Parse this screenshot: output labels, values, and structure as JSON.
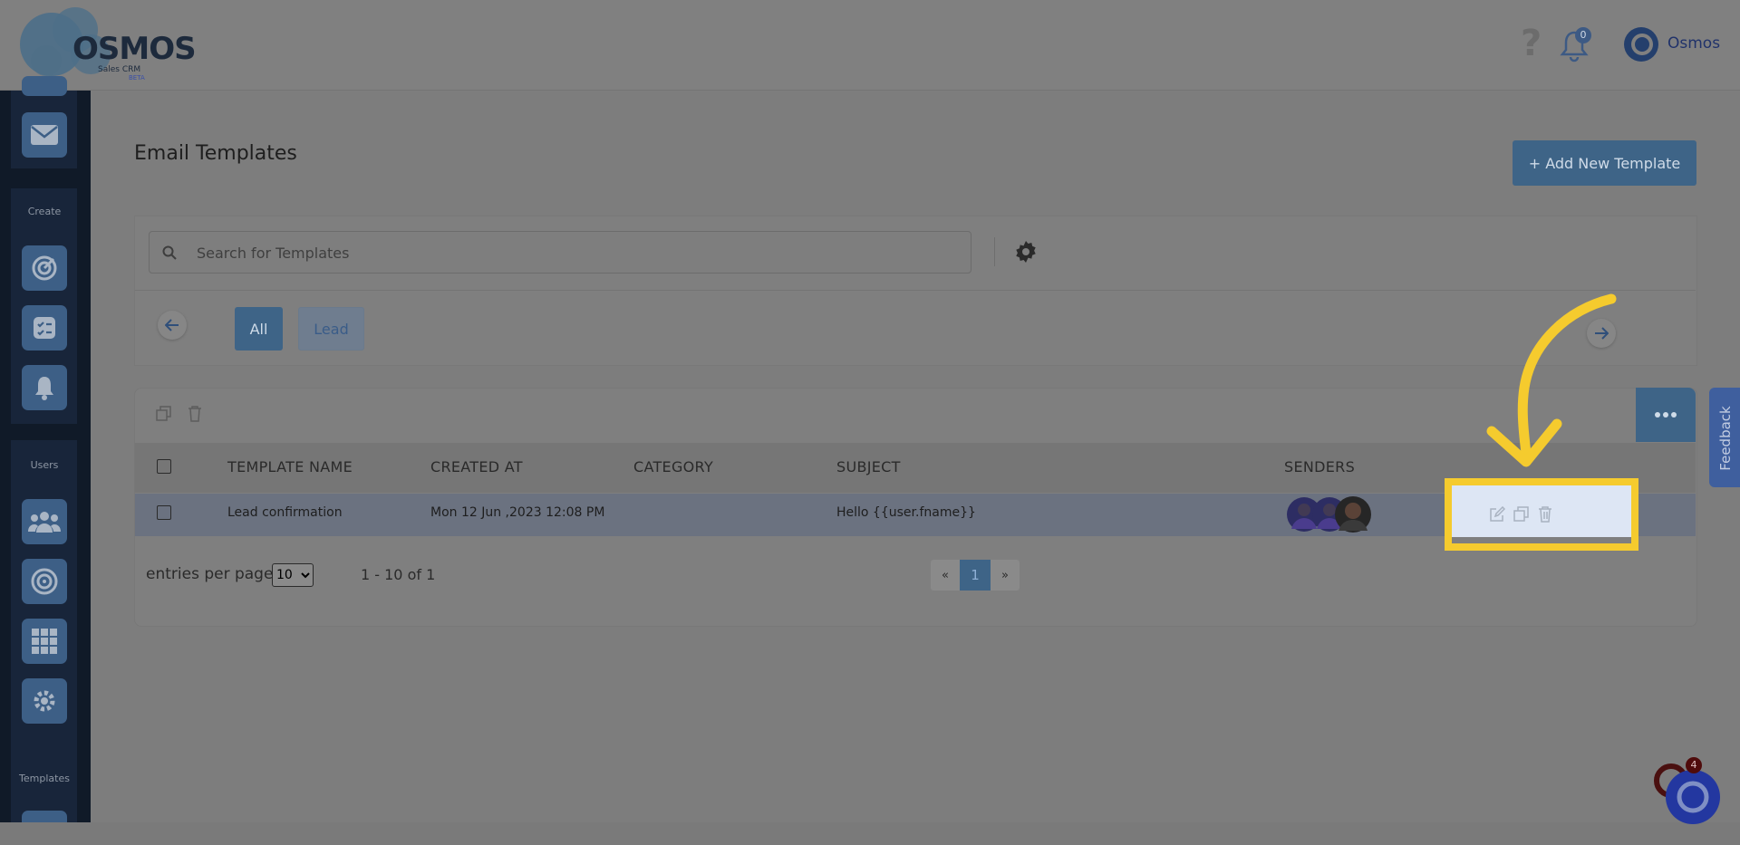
{
  "brand": {
    "logo_text": "OSMOS",
    "logo_sub": "Sales CRM",
    "logo_beta": "BETA"
  },
  "header": {
    "help_symbol": "?",
    "notification_count": "0",
    "user_name": "Osmos"
  },
  "sidebar": {
    "sections": {
      "create": "Create",
      "users": "Users",
      "templates": "Templates"
    }
  },
  "page": {
    "title": "Email Templates",
    "add_button": "+ Add New Template"
  },
  "search": {
    "placeholder": "Search for Templates"
  },
  "filters": {
    "all": "All",
    "lead": "Lead"
  },
  "table": {
    "headers": {
      "name": "TEMPLATE NAME",
      "created": "CREATED AT",
      "category": "CATEGORY",
      "subject": "SUBJECT",
      "senders": "SENDERS"
    },
    "rows": [
      {
        "name": "Lead confirmation",
        "created": "Mon 12 Jun ,2023 12:08 PM",
        "category": "",
        "subject": "Hello {{user.fname}}"
      }
    ]
  },
  "pagination": {
    "entries_label": "entries per page",
    "entries_options": [
      "10"
    ],
    "range": "1 - 10 of 1",
    "prev": "«",
    "current": "1",
    "next": "»"
  },
  "feedback": {
    "label": "Feedback"
  },
  "chat": {
    "badge": "4"
  },
  "colors": {
    "accent": "#3e6487",
    "highlight": "#f5cb2e"
  }
}
